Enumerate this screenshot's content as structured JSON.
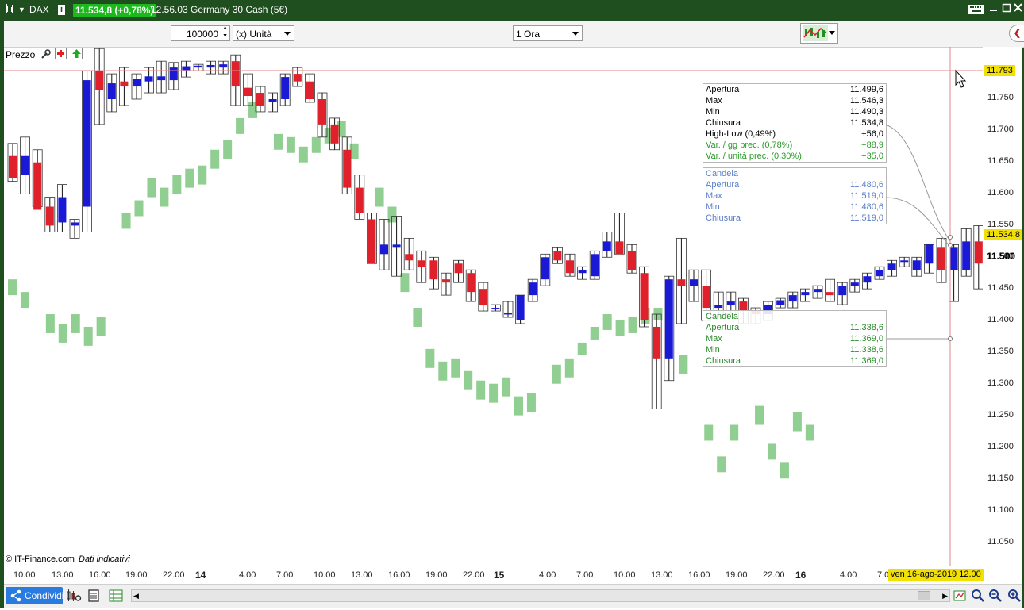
{
  "window": {
    "symbol": "DAX",
    "info_glyph": "i",
    "price_badge": "11.534,8 (+0,78%)",
    "title": "12.56.03 Germany 30 Cash (5€)"
  },
  "toolbar": {
    "quantity": "100000",
    "unit_select": "(x) Unità",
    "timeframe_select": "1 Ora"
  },
  "chart_panel": {
    "label": "Prezzo"
  },
  "copyright": "© IT-Finance.com",
  "data_note": "Dati indicativi",
  "yaxis": {
    "ticks": [
      "11.750",
      "11.700",
      "11.650",
      "11.600",
      "11.550",
      "11.500",
      "11.450",
      "11.400",
      "11.350",
      "11.300",
      "11.250",
      "11.200",
      "11.150",
      "11.100",
      "11.050"
    ],
    "cursor_label": "11.793",
    "last_price_label": "11.534,8",
    "bold_label": "11.500"
  },
  "xaxis": {
    "labels": [
      {
        "text": "10.00",
        "bold": false
      },
      {
        "text": "13.00",
        "bold": false
      },
      {
        "text": "16.00",
        "bold": false
      },
      {
        "text": "19.00",
        "bold": false
      },
      {
        "text": "22.00",
        "bold": false
      },
      {
        "text": "14",
        "bold": true
      },
      {
        "text": "4.00",
        "bold": false
      },
      {
        "text": "7.00",
        "bold": false
      },
      {
        "text": "10.00",
        "bold": false
      },
      {
        "text": "13.00",
        "bold": false
      },
      {
        "text": "16.00",
        "bold": false
      },
      {
        "text": "19.00",
        "bold": false
      },
      {
        "text": "22.00",
        "bold": false
      },
      {
        "text": "15",
        "bold": true
      },
      {
        "text": "4.00",
        "bold": false
      },
      {
        "text": "7.00",
        "bold": false
      },
      {
        "text": "10.00",
        "bold": false
      },
      {
        "text": "13.00",
        "bold": false
      },
      {
        "text": "16.00",
        "bold": false
      },
      {
        "text": "19.00",
        "bold": false
      },
      {
        "text": "22.00",
        "bold": false
      },
      {
        "text": "16",
        "bold": true
      },
      {
        "text": "4.00",
        "bold": false
      },
      {
        "text": "7.0",
        "bold": false
      }
    ],
    "cursor_label": "ven 16-ago-2019 12.00"
  },
  "info_main": {
    "rows": [
      {
        "label": "Apertura",
        "value": "11.499,6"
      },
      {
        "label": "Max",
        "value": "11.546,3"
      },
      {
        "label": "Min",
        "value": "11.490,3"
      },
      {
        "label": "Chiusura",
        "value": "11.534,8"
      },
      {
        "label": "High-Low (0,49%)",
        "value": "+56,0"
      },
      {
        "label": "Var. / gg prec. (0,78%)",
        "value": "+88,9"
      },
      {
        "label": "Var. / unità prec. (0,30%)",
        "value": "+35,0"
      }
    ]
  },
  "info_candle_blue": {
    "title": "Candela",
    "rows": [
      {
        "label": "Apertura",
        "value": "11.480,6"
      },
      {
        "label": "Max",
        "value": "11.519,0"
      },
      {
        "label": "Min",
        "value": "11.480,6"
      },
      {
        "label": "Chiusura",
        "value": "11.519,0"
      }
    ]
  },
  "info_candle_green": {
    "title": "Candela",
    "rows": [
      {
        "label": "Apertura",
        "value": "11.338,6"
      },
      {
        "label": "Max",
        "value": "11.369,0"
      },
      {
        "label": "Min",
        "value": "11.338,6"
      },
      {
        "label": "Chiusura",
        "value": "11.369,0"
      }
    ]
  },
  "bottombar": {
    "share_label": "Condividi"
  },
  "colors": {
    "bull": "#1a1ad6",
    "bear": "#e0202a",
    "indicator": "#7ec67e",
    "crosshair": "#e38a8a",
    "axis_highlight": "#f2e000"
  },
  "chart_data": {
    "type": "candlestick",
    "ylim": [
      11020,
      11820
    ],
    "candles": [
      [
        11660,
        11680,
        11620,
        11625
      ],
      [
        11630,
        11690,
        11600,
        11660
      ],
      [
        11650,
        11670,
        11580,
        11575
      ],
      [
        11580,
        11595,
        11540,
        11550
      ],
      [
        11555,
        11615,
        11540,
        11595
      ],
      [
        11550,
        11560,
        11530,
        11555
      ],
      [
        11580,
        11795,
        11540,
        11780
      ],
      [
        11795,
        11830,
        11710,
        11765
      ],
      [
        11750,
        11790,
        11730,
        11775
      ],
      [
        11778,
        11800,
        11740,
        11770
      ],
      [
        11770,
        11790,
        11750,
        11782
      ],
      [
        11778,
        11800,
        11760,
        11786
      ],
      [
        11780,
        11810,
        11760,
        11786
      ],
      [
        11780,
        11808,
        11765,
        11800
      ],
      [
        11796,
        11810,
        11785,
        11802
      ],
      [
        11800,
        11805,
        11795,
        11803
      ],
      [
        11800,
        11810,
        11790,
        11804
      ],
      [
        11800,
        11810,
        11790,
        11805
      ],
      [
        11810,
        11820,
        11740,
        11770
      ],
      [
        11768,
        11790,
        11740,
        11755
      ],
      [
        11760,
        11770,
        11730,
        11740
      ],
      [
        11745,
        11760,
        11730,
        11750
      ],
      [
        11750,
        11790,
        11740,
        11785
      ],
      [
        11790,
        11800,
        11770,
        11778
      ],
      [
        11778,
        11790,
        11745,
        11750
      ],
      [
        11750,
        11760,
        11690,
        11710
      ],
      [
        11710,
        11720,
        11670,
        11680
      ],
      [
        11670,
        11690,
        11600,
        11610
      ],
      [
        11610,
        11630,
        11560,
        11570
      ],
      [
        11560,
        11570,
        11490,
        11490
      ],
      [
        11505,
        11560,
        11480,
        11520
      ],
      [
        11515,
        11565,
        11470,
        11520
      ],
      [
        11505,
        11530,
        11480,
        11495
      ],
      [
        11495,
        11510,
        11460,
        11485
      ],
      [
        11495,
        11500,
        11450,
        11465
      ],
      [
        11465,
        11475,
        11440,
        11460
      ],
      [
        11490,
        11495,
        11460,
        11475
      ],
      [
        11475,
        11480,
        11430,
        11445
      ],
      [
        11450,
        11460,
        11415,
        11425
      ],
      [
        11418,
        11425,
        11415,
        11420
      ],
      [
        11412,
        11430,
        11405,
        11412
      ],
      [
        11400,
        11440,
        11395,
        11440
      ],
      [
        11440,
        11465,
        11430,
        11460
      ],
      [
        11465,
        11505,
        11455,
        11500
      ],
      [
        11510,
        11515,
        11490,
        11495
      ],
      [
        11495,
        11505,
        11470,
        11475
      ],
      [
        11475,
        11485,
        11465,
        11480
      ],
      [
        11470,
        11510,
        11465,
        11505
      ],
      [
        11510,
        11540,
        11500,
        11525
      ],
      [
        11525,
        11570,
        11505,
        11505
      ],
      [
        11510,
        11520,
        11475,
        11480
      ],
      [
        11475,
        11485,
        11390,
        11400
      ],
      [
        11390,
        11410,
        11260,
        11340
      ],
      [
        11340,
        11470,
        11305,
        11465
      ],
      [
        11465,
        11530,
        11395,
        11455
      ],
      [
        11455,
        11480,
        11430,
        11465
      ],
      [
        11455,
        11480,
        11400,
        11420
      ],
      [
        11420,
        11445,
        11405,
        11425
      ],
      [
        11425,
        11445,
        11410,
        11430
      ],
      [
        11430,
        11435,
        11395,
        11415
      ],
      [
        11415,
        11420,
        11395,
        11410
      ],
      [
        11410,
        11430,
        11400,
        11425
      ],
      [
        11425,
        11435,
        11420,
        11432
      ],
      [
        11430,
        11445,
        11420,
        11440
      ],
      [
        11440,
        11450,
        11430,
        11445
      ],
      [
        11445,
        11455,
        11435,
        11450
      ],
      [
        11445,
        11465,
        11430,
        11440
      ],
      [
        11440,
        11460,
        11425,
        11455
      ],
      [
        11455,
        11465,
        11445,
        11460
      ],
      [
        11460,
        11475,
        11450,
        11470
      ],
      [
        11470,
        11485,
        11465,
        11480
      ],
      [
        11480,
        11495,
        11470,
        11490
      ],
      [
        11495,
        11500,
        11485,
        11495
      ],
      [
        11480,
        11500,
        11470,
        11495
      ],
      [
        11490,
        11520,
        11475,
        11520
      ],
      [
        11515,
        11530,
        11460,
        11480
      ],
      [
        11480,
        11520,
        11430,
        11515
      ],
      [
        11480,
        11545,
        11470,
        11525
      ],
      [
        11525,
        11550,
        11450,
        11490
      ],
      [
        11500,
        11546,
        11490,
        11535
      ]
    ],
    "indicator": [
      [
        11440,
        11465
      ],
      [
        11420,
        11445
      ],
      null,
      [
        11380,
        11410
      ],
      [
        11365,
        11395
      ],
      [
        11380,
        11410
      ],
      [
        11360,
        11390
      ],
      [
        11375,
        11405
      ],
      null,
      [
        11545,
        11570
      ],
      [
        11565,
        11590
      ],
      [
        11595,
        11625
      ],
      [
        11580,
        11610
      ],
      [
        11600,
        11630
      ],
      [
        11610,
        11640
      ],
      [
        11615,
        11645
      ],
      [
        11640,
        11670
      ],
      [
        11655,
        11685
      ],
      [
        11695,
        11720
      ],
      [
        11720,
        11745
      ],
      null,
      [
        11670,
        11695
      ],
      [
        11665,
        11690
      ],
      [
        11650,
        11675
      ],
      [
        11665,
        11690
      ],
      [
        11680,
        11705
      ],
      [
        11690,
        11715
      ],
      [
        11655,
        11680
      ],
      null,
      [
        11580,
        11610
      ],
      [
        11555,
        11580
      ],
      [
        11445,
        11475
      ],
      [
        11390,
        11420
      ],
      [
        11325,
        11355
      ],
      [
        11305,
        11335
      ],
      [
        11310,
        11340
      ],
      [
        11290,
        11320
      ],
      [
        11275,
        11305
      ],
      [
        11270,
        11300
      ],
      [
        11280,
        11310
      ],
      [
        11250,
        11280
      ],
      [
        11255,
        11285
      ],
      null,
      [
        11300,
        11330
      ],
      [
        11310,
        11340
      ],
      [
        11345,
        11365
      ],
      [
        11370,
        11390
      ],
      [
        11385,
        11410
      ],
      [
        11375,
        11400
      ],
      [
        11380,
        11405
      ],
      [
        11395,
        11420
      ],
      [
        11400,
        11420
      ],
      null,
      [
        11315,
        11345
      ],
      null,
      [
        11210,
        11235
      ],
      [
        11160,
        11185
      ],
      [
        11210,
        11235
      ],
      null,
      [
        11235,
        11265
      ],
      [
        11180,
        11205
      ],
      [
        11150,
        11175
      ],
      [
        11225,
        11255
      ],
      [
        11210,
        11235
      ]
    ]
  }
}
